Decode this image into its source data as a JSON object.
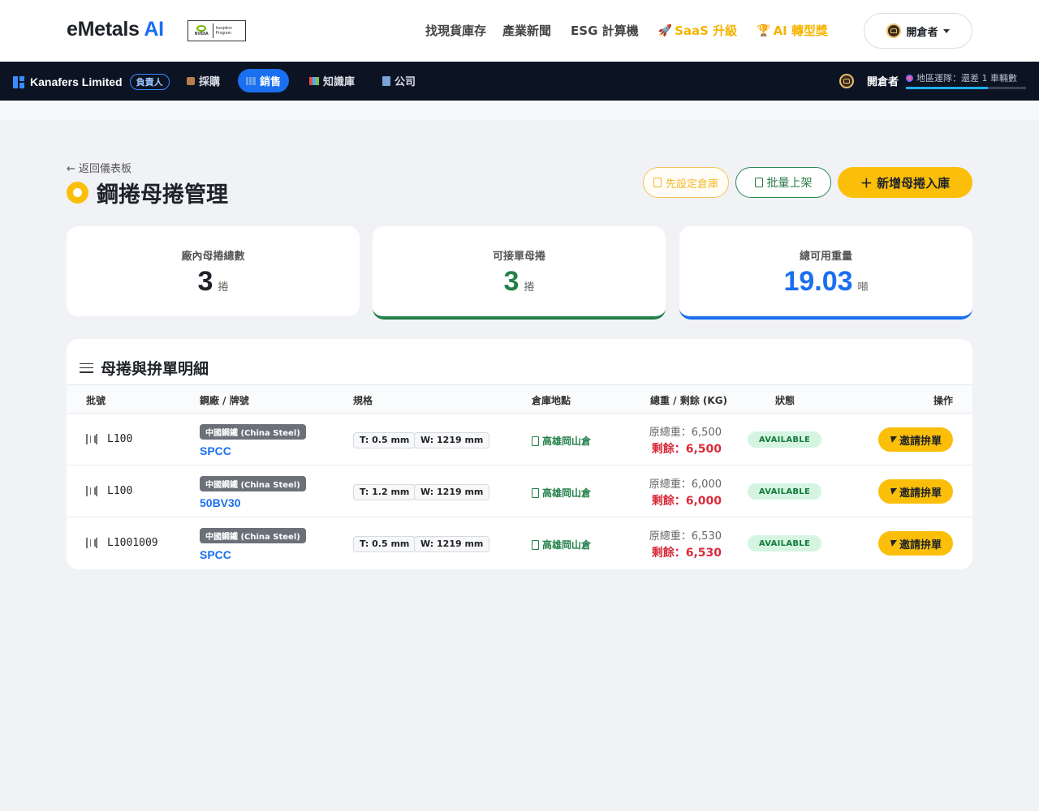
{
  "header": {
    "brand_main": "eMetals",
    "brand_ai": "AI",
    "badge_line1": "NVIDIA",
    "badge_line2": "Inception Program",
    "nav": [
      {
        "label": "找現貨庫存",
        "icon": ""
      },
      {
        "label": "產業新聞",
        "icon": ""
      },
      {
        "label": "ESG 計算機",
        "icon": ""
      },
      {
        "label": "SaaS 升級",
        "icon": "rocket-icon"
      },
      {
        "label": "AI 轉型獎",
        "icon": "trophy-icon"
      }
    ],
    "user_label": "開倉者"
  },
  "subnav": {
    "company": "Kanafers Limited",
    "role": "負責人",
    "items": [
      {
        "label": "採購",
        "icon": "box-icon"
      },
      {
        "label": "銷售",
        "icon": "factory-icon"
      },
      {
        "label": "知識庫",
        "icon": "books-icon"
      },
      {
        "label": "公司",
        "icon": "building-icon"
      }
    ],
    "user_label": "開倉者",
    "geo_text": "地區運隊：還差 1 車輛數",
    "geo_progress": 0.68
  },
  "page": {
    "back_label": "← 返回儀表板",
    "title": "鋼捲母捲管理",
    "buttons": {
      "warehouse": "先設定倉庫",
      "batch": "批量上架",
      "add": "＋ 新增母捲入庫"
    }
  },
  "stats": [
    {
      "label": "廠內母捲總數",
      "value": "3",
      "unit": "捲"
    },
    {
      "label": "可接單母捲",
      "value": "3",
      "unit": "捲"
    },
    {
      "label": "總可用重量",
      "value": "19.03",
      "unit": "噸"
    }
  ],
  "table": {
    "title": "母捲與拚單明細",
    "headers": {
      "batch": "批號",
      "mill": "鋼廠 / 牌號",
      "spec": "規格",
      "location": "倉庫地點",
      "weight": "總重 / 剩餘 (KG)",
      "status": "狀態",
      "action": "操作"
    },
    "rows": [
      {
        "batch": "L100",
        "mill": "中國鋼鐵 (China Steel)",
        "grade": "SPCC",
        "thickness": "T: 0.5 mm",
        "width": "W: 1219 mm",
        "location": "高雄岡山倉",
        "original": "原總重：6,500",
        "remaining": "剩餘：6,500",
        "status": "AVAILABLE",
        "action": "邀請拚單"
      },
      {
        "batch": "L100",
        "mill": "中國鋼鐵 (China Steel)",
        "grade": "50BV30",
        "thickness": "T: 1.2 mm",
        "width": "W: 1219 mm",
        "location": "高雄岡山倉",
        "original": "原總重：6,000",
        "remaining": "剩餘：6,000",
        "status": "AVAILABLE",
        "action": "邀請拚單"
      },
      {
        "batch": "L1001009",
        "mill": "中國鋼鐵 (China Steel)",
        "grade": "SPCC",
        "thickness": "T: 0.5 mm",
        "width": "W: 1219 mm",
        "location": "高雄岡山倉",
        "original": "原總重：6,530",
        "remaining": "剩餘：6,530",
        "status": "AVAILABLE",
        "action": "邀請拚單"
      }
    ]
  },
  "colors": {
    "accent_blue": "#1a6ff0",
    "accent_yellow": "#fbbf0a",
    "success_green": "#23804a",
    "danger_red": "#d92c3a",
    "dark_nav": "#0c1424"
  }
}
